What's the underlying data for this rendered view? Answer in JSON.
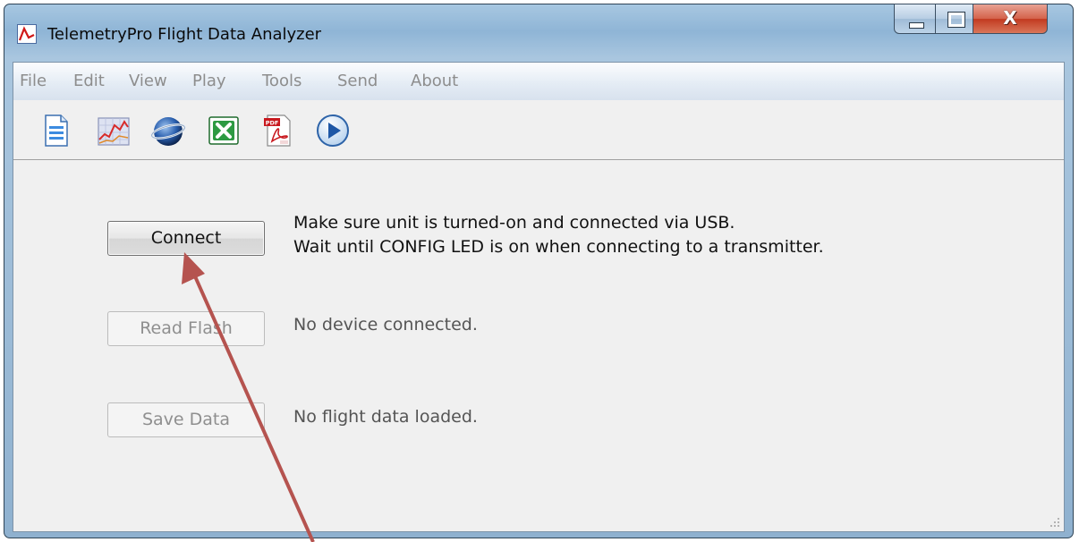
{
  "window": {
    "title": "TelemetryPro Flight Data Analyzer",
    "controls": {
      "minimize": "minimize",
      "maximize": "maximize",
      "close": "X"
    }
  },
  "menu": [
    "File",
    "Edit",
    "View",
    "Play",
    "Tools",
    "Send",
    "About"
  ],
  "toolbar_icons": [
    "document-icon",
    "chart-icon",
    "globe-icon",
    "excel-icon",
    "pdf-icon",
    "play-icon"
  ],
  "rows": [
    {
      "button": "Connect",
      "enabled": true,
      "message_line1": "Make sure unit is turned-on and connected via USB.",
      "message_line2": "Wait until CONFIG LED is on when connecting to a transmitter."
    },
    {
      "button": "Read Flash",
      "enabled": false,
      "message_line1": "No device connected."
    },
    {
      "button": "Save Data",
      "enabled": false,
      "message_line1": "No flight data loaded."
    }
  ],
  "colors": {
    "annotation_arrow": "#b5534f",
    "title_glass": "#a7c7e1",
    "close_button": "#c94a2f"
  }
}
